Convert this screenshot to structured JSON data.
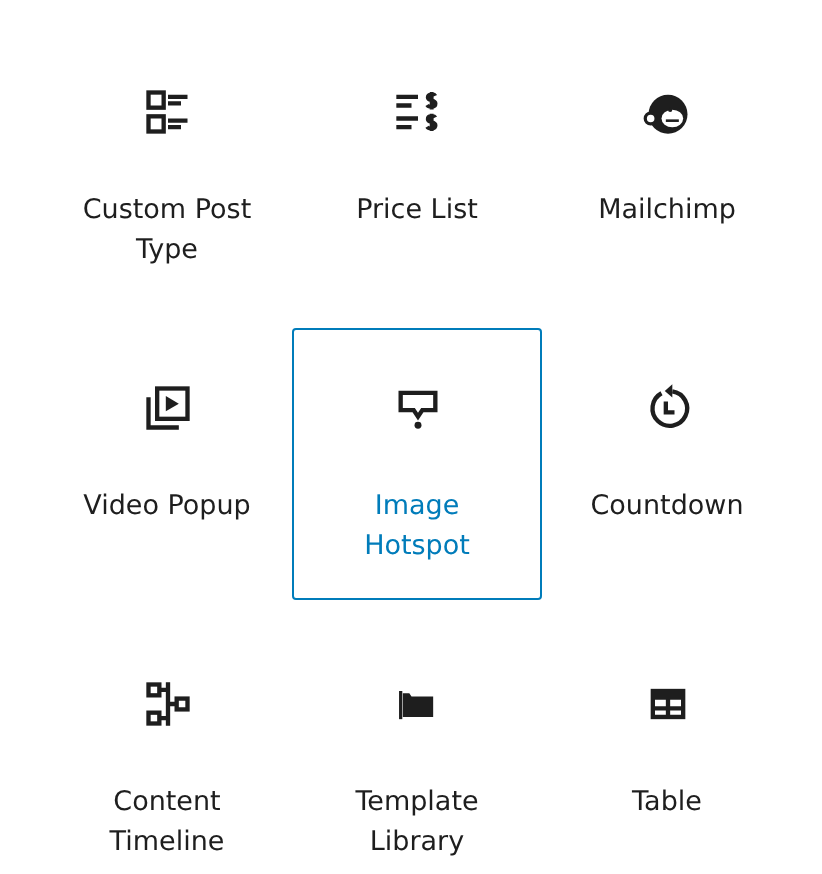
{
  "blocks": [
    {
      "label": "Custom Post Type",
      "selected": false
    },
    {
      "label": "Price List",
      "selected": false
    },
    {
      "label": "Mailchimp",
      "selected": false
    },
    {
      "label": "Video Popup",
      "selected": false
    },
    {
      "label": "Image Hotspot",
      "selected": true
    },
    {
      "label": "Countdown",
      "selected": false
    },
    {
      "label": "Content Timeline",
      "selected": false
    },
    {
      "label": "Template Library",
      "selected": false
    },
    {
      "label": "Table",
      "selected": false
    }
  ]
}
